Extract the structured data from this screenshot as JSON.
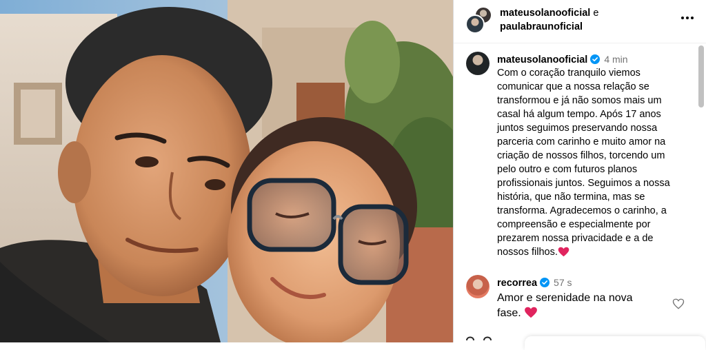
{
  "header": {
    "user1": "mateusolanooficial",
    "conjunction": "e",
    "user2": "paulabraunoficial",
    "more_icon": "ellipsis-horizontal-icon"
  },
  "caption": {
    "username": "mateusolanooficial",
    "verified": true,
    "time": "4 min",
    "lines": [
      "Com o coração tranquilo viemos",
      "comunicar que a nossa relação se",
      "transformou e já não somos mais um",
      "casal há algum tempo. Após 17 anos",
      "juntos seguimos preservando nossa",
      "parceria com carinho e muito amor na",
      "criação de nossos filhos, torcendo um",
      "pelo outro e com futuros planos",
      "profissionais juntos. Seguimos a nossa",
      "história, que não termina, mas se",
      "transforma. Agradecemos o carinho, a",
      "compreensão e especialmente por",
      "prezarem nossa privacidade e a de",
      "nossos filhos."
    ],
    "emoji": "red-heart"
  },
  "comment": {
    "username": "recorrea",
    "verified": true,
    "time": "57 s",
    "text_line1": "Amor e serenidade na nova",
    "text_line2": "fase.",
    "emoji": "red-heart",
    "like_icon": "heart-outline-icon"
  },
  "colors": {
    "verified_blue": "#0095f6",
    "heart_red": "#e0245e",
    "muted_text": "#737373",
    "divider": "#dbdbdb"
  }
}
